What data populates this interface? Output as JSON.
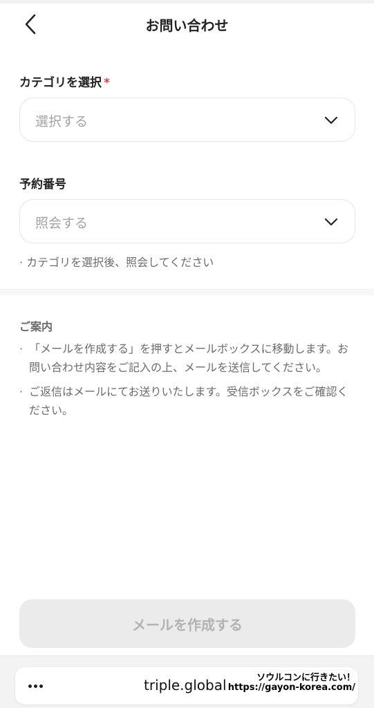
{
  "header": {
    "title": "お問い合わせ"
  },
  "category": {
    "label": "カテゴリを選択",
    "required_mark": "*",
    "placeholder": "選択する"
  },
  "reservation": {
    "label": "予約番号",
    "placeholder": "照会する",
    "hint": "· カテゴリを選択後、照会してください"
  },
  "info": {
    "title": "ご案内",
    "bullet": "·",
    "items": [
      "「メールを作成する」を押すとメールボックスに移動します。お問い合わせ内容をご記入の上、メールを送信してください。",
      "ご返信はメールにてお送りいたします。受信ボックスをご確認ください。"
    ]
  },
  "submit": {
    "label": "メールを作成する"
  },
  "browser": {
    "domain": "triple.global",
    "overlay_line1": "ソウルコンに行きたい！",
    "overlay_line2": "https://gayon-korea.com/"
  },
  "icons": {
    "back": "chevron-left-icon",
    "select_arrow": "chevron-down-icon",
    "more": "more-dots-icon"
  }
}
